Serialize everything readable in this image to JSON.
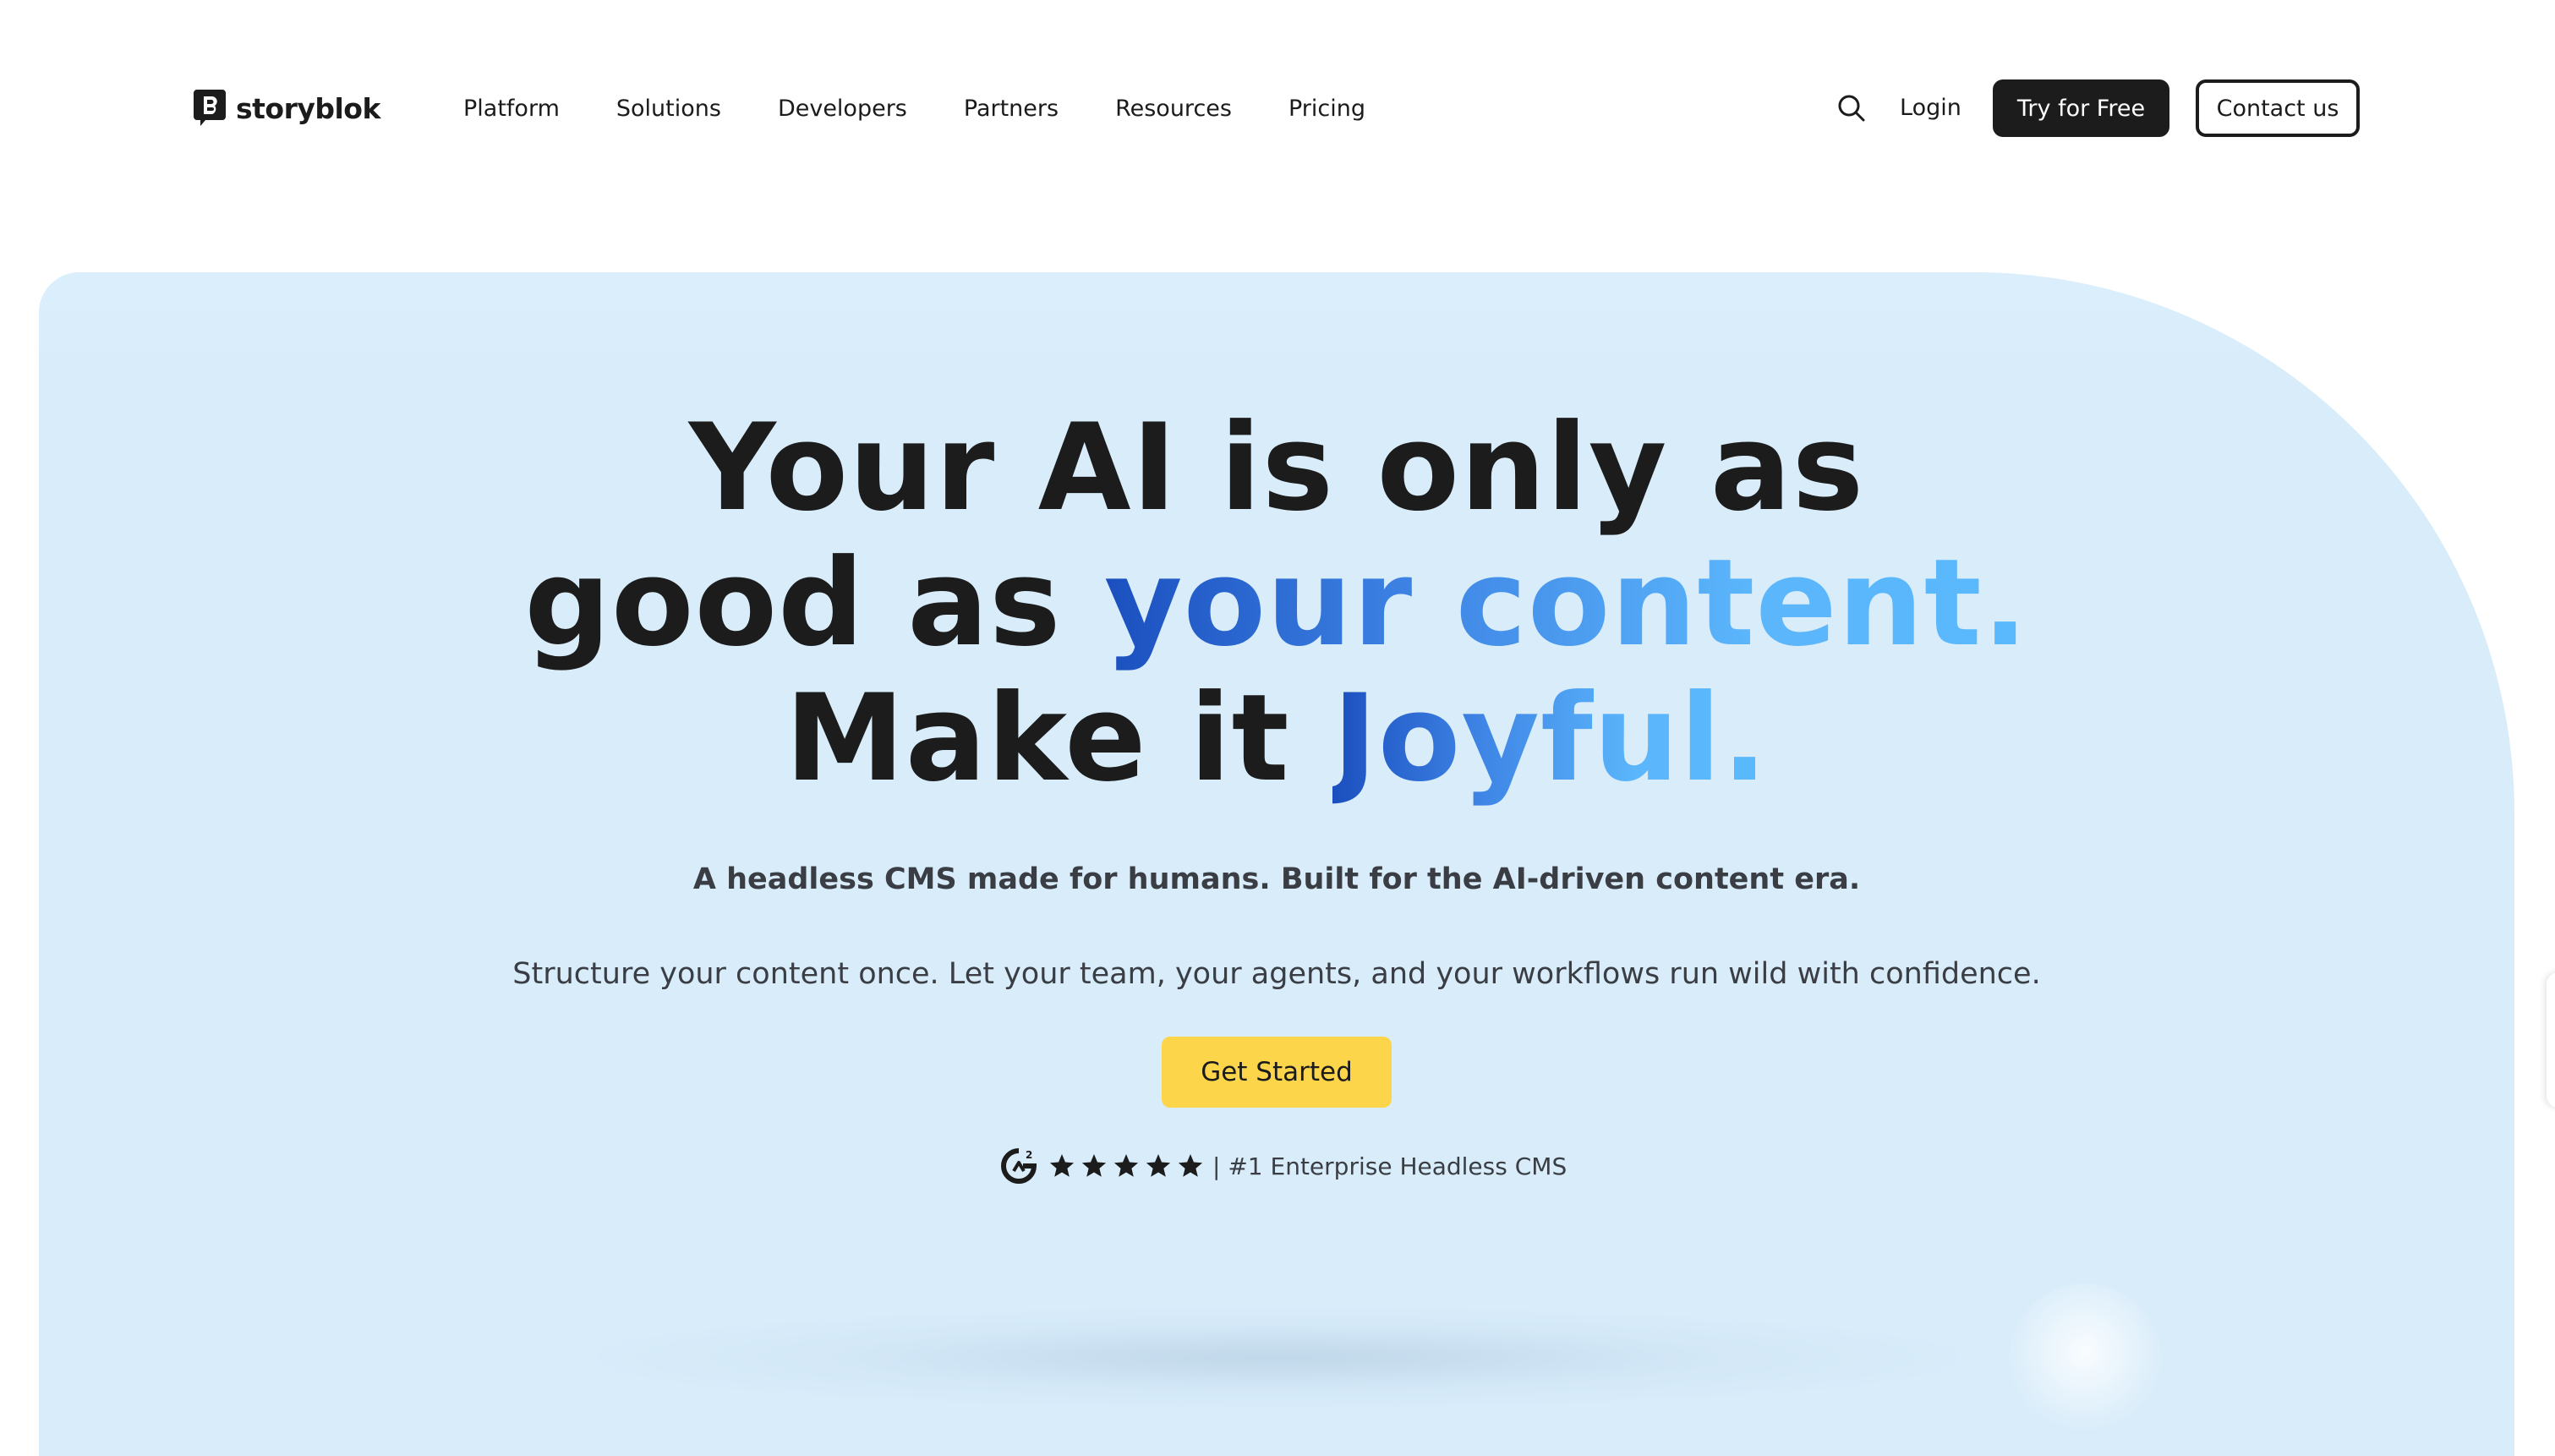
{
  "header": {
    "logo_text": "storyblok",
    "nav": [
      {
        "label": "Platform"
      },
      {
        "label": "Solutions"
      },
      {
        "label": "Developers"
      },
      {
        "label": "Partners"
      },
      {
        "label": "Resources"
      },
      {
        "label": "Pricing"
      }
    ],
    "search_icon": "search-icon",
    "login_label": "Login",
    "try_label": "Try for Free",
    "contact_label": "Contact us"
  },
  "hero": {
    "headline_line1": "Your AI is only as",
    "headline_line2_plain": "good as ",
    "headline_line2_accent": "your content.",
    "headline_line3_plain": "Make it ",
    "headline_line3_accent": "Joyful.",
    "subtitle": "A headless CMS made for humans. Built for the AI-driven content era.",
    "description": "Structure your content once. Let your team, your agents, and your workflows run wild with confidence.",
    "cta_label": "Get Started",
    "rating": {
      "source_icon": "g2-logo-icon",
      "stars": 5,
      "text": "| #1 Enterprise Headless CMS"
    }
  },
  "colors": {
    "hero_background": "#d8ecfa",
    "accent_gradient_start": "#1b4fbf",
    "accent_gradient_end": "#5ab8fc",
    "cta_background": "#fdd54b",
    "primary_button": "#1c1c1c"
  }
}
